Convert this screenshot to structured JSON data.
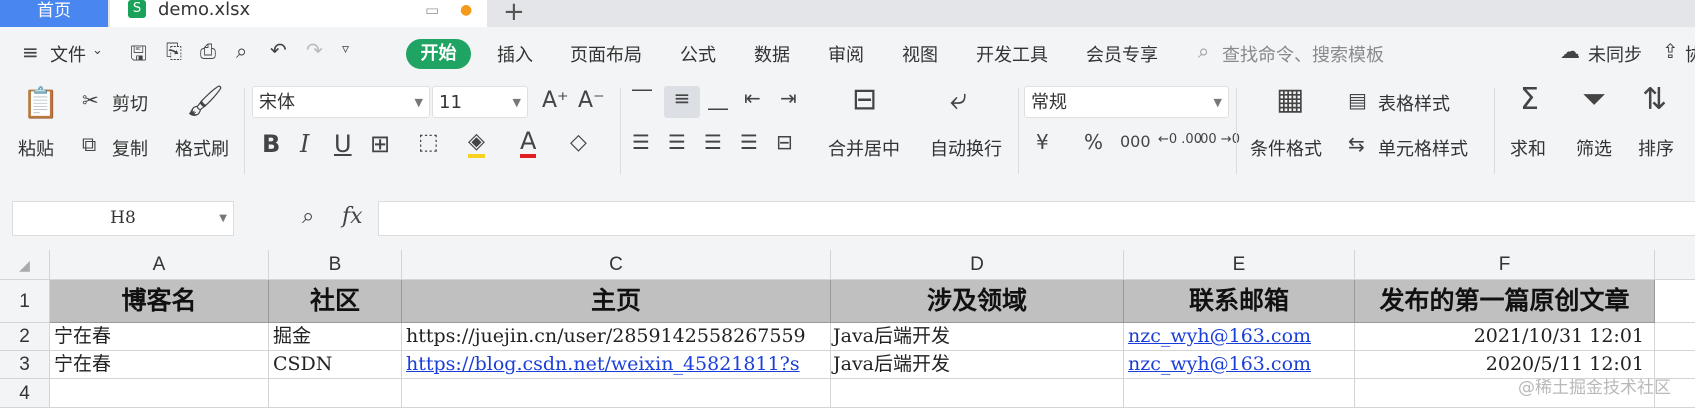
{
  "tabs": {
    "home": "首页",
    "file": "demo.xlsx",
    "new": "+"
  },
  "menu": {
    "file": "文件",
    "items": [
      "开始",
      "插入",
      "页面布局",
      "公式",
      "数据",
      "审阅",
      "视图",
      "开发工具",
      "会员专享"
    ],
    "search_placeholder": "查找命令、搜索模板",
    "sync": "未同步",
    "share": "协"
  },
  "ribbon": {
    "paste": "粘贴",
    "cut": "剪切",
    "copy": "复制",
    "format_painter": "格式刷",
    "font_name": "宋体",
    "font_size": "11",
    "bold": "B",
    "italic": "I",
    "underline": "U",
    "font_color_glyph": "A",
    "merge_center": "合并居中",
    "wrap_text": "自动换行",
    "number_format": "常规",
    "currency": "¥",
    "percent": "%",
    "thousands": "000",
    "inc_decimal": "←0 .00",
    "dec_decimal": ".00 →0",
    "cond_format": "条件格式",
    "table_style": "表格样式",
    "cell_style": "单元格样式",
    "sum": "求和",
    "filter": "筛选",
    "sort": "排序"
  },
  "formula_bar": {
    "name_box": "H8",
    "fx": "fx",
    "value": ""
  },
  "sheet": {
    "columns": [
      "A",
      "B",
      "C",
      "D",
      "E",
      "F"
    ],
    "rows": [
      "1",
      "2",
      "3",
      "4"
    ],
    "header": [
      "博客名",
      "社区",
      "主页",
      "涉及领域",
      "联系邮箱",
      "发布的第一篇原创文章"
    ],
    "data": [
      [
        "宁在春",
        "掘金",
        "https://juejin.cn/user/2859142558267559",
        "Java后端开发",
        "nzc_wyh@163.com",
        "2021/10/31 12:01"
      ],
      [
        "宁在春",
        "CSDN",
        "https://blog.csdn.net/weixin_45821811?s",
        "Java后端开发",
        "nzc_wyh@163.com",
        "2020/5/11 12:01"
      ]
    ]
  },
  "watermark": "@稀土掘金技术社区"
}
